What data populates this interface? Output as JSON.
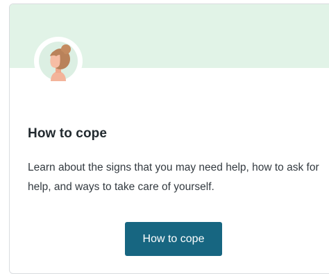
{
  "card": {
    "title": "How to cope",
    "description": "Learn about the signs that you may need help, how to ask for help, and ways to take care of yourself.",
    "button_label": "How to cope",
    "avatar_icon": "woman-with-bun-icon"
  },
  "colors": {
    "banner": "#e1f3e7",
    "button": "#176681",
    "button_text": "#ffffff",
    "title": "#222a2f",
    "text": "#333a40"
  }
}
